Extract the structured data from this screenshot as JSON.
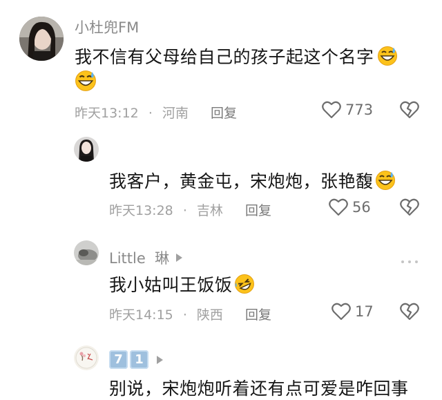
{
  "comments": [
    {
      "username": "小杜兜FM",
      "text_line1": "我不信有父母给自己的孩子起这个名字",
      "time": "昨天13:12",
      "location": "河南",
      "reply_label": "回复",
      "likes": "773",
      "emoji": "grinning-sweat-face-icon"
    },
    {
      "username": "",
      "text": "我客户，黄金屯，宋炮炮，张艳馥",
      "time": "昨天13:28",
      "location": "吉林",
      "reply_label": "回复",
      "likes": "56",
      "emoji": "grinning-sweat-face-icon"
    },
    {
      "username": "Little  琳",
      "text": "我小姑叫王饭饭",
      "time": "昨天14:15",
      "location": "陕西",
      "reply_label": "回复",
      "likes": "17",
      "emoji": "rolling-laughing-face-icon"
    },
    {
      "username_badges": [
        "7",
        "1"
      ],
      "text": "别说，宋炮炮听着还有点可爱是咋回事"
    }
  ],
  "separator": "·"
}
